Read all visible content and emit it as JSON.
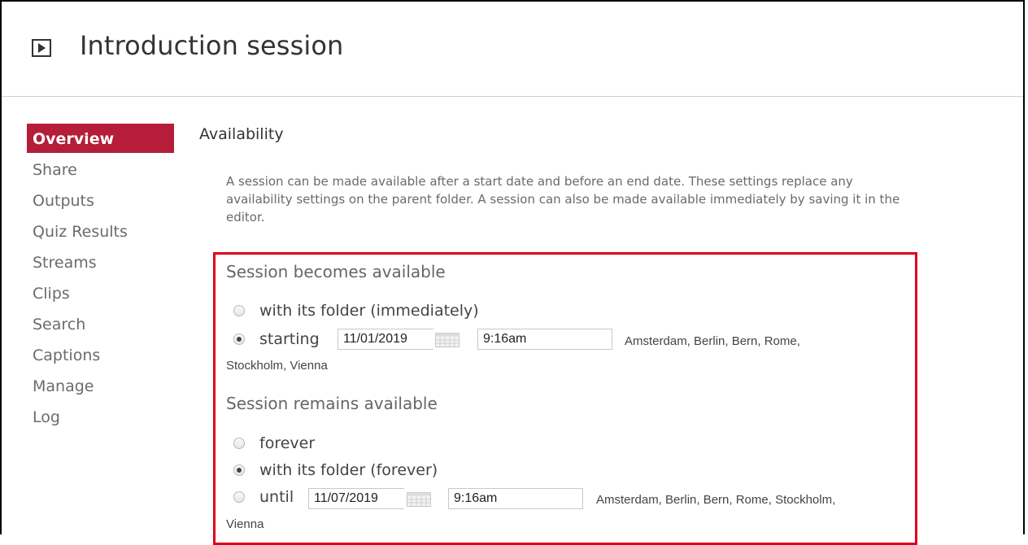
{
  "header": {
    "title": "Introduction session",
    "icon": "play-box-icon"
  },
  "sidebar": {
    "items": [
      {
        "label": "Overview",
        "active": true
      },
      {
        "label": "Share"
      },
      {
        "label": "Outputs"
      },
      {
        "label": "Quiz Results"
      },
      {
        "label": "Streams"
      },
      {
        "label": "Clips"
      },
      {
        "label": "Search"
      },
      {
        "label": "Captions"
      },
      {
        "label": "Manage"
      },
      {
        "label": "Log"
      }
    ],
    "active_color": "#b51d38"
  },
  "availability": {
    "title": "Availability",
    "description": "A session can be made available after a start date and before an end date. These settings replace any availability settings on the parent folder. A session can also be made available immediately by saving it in the editor.",
    "start": {
      "heading": "Session becomes available",
      "option_folder": "with its folder (immediately)",
      "option_starting": "starting",
      "date": "11/01/2019",
      "time": "9:16am",
      "timezone_line1": "Amsterdam, Berlin, Bern, Rome,",
      "timezone_line2": "Stockholm, Vienna",
      "selected": "starting"
    },
    "end": {
      "heading": "Session remains available",
      "option_forever": "forever",
      "option_folder": "with its folder (forever)",
      "option_until": "until",
      "date": "11/07/2019",
      "time": "9:16am",
      "timezone_line1": "Amsterdam, Berlin, Bern, Rome, Stockholm,",
      "timezone_line2": "Vienna",
      "selected": "with its folder (forever)"
    },
    "highlight_color": "#e0001b"
  }
}
